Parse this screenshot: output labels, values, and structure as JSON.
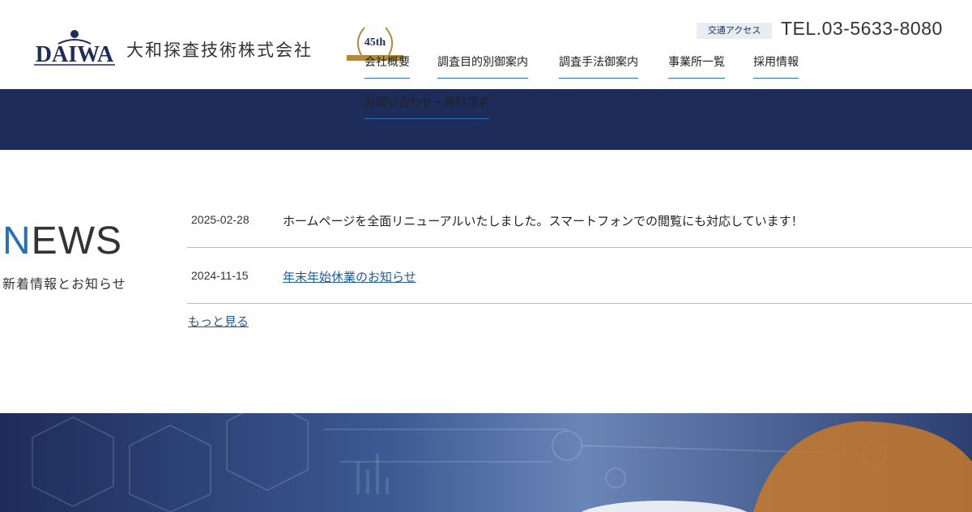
{
  "header": {
    "logo_text": "DAIWA",
    "company_name": "大和探査技術株式会社",
    "anniversary_badge": "45th",
    "access_label": "交通アクセス",
    "tel": "TEL.03-5633-8080"
  },
  "nav": {
    "items": [
      {
        "label": "会社概要"
      },
      {
        "label": "調査目的別御案内"
      },
      {
        "label": "調査手法御案内"
      },
      {
        "label": "事業所一覧"
      },
      {
        "label": "採用情報"
      },
      {
        "label": "お問い合わせ・資料請求"
      }
    ]
  },
  "news": {
    "heading_accent": "N",
    "heading_rest": "EWS",
    "subheading": "新着情報とお知らせ",
    "items": [
      {
        "date": "2025-02-28",
        "text": "ホームページを全面リニューアルいたしました。スマートフォンでの閲覧にも対応しています！"
      },
      {
        "date": "2024-11-15",
        "text": "年末年始休業のお知らせ"
      }
    ],
    "more_label": "もっと見る"
  },
  "colors": {
    "navy": "#1e2c5a",
    "accent_blue": "#2a6fb0",
    "link": "#1e5a99",
    "gold": "#b08a3e"
  }
}
